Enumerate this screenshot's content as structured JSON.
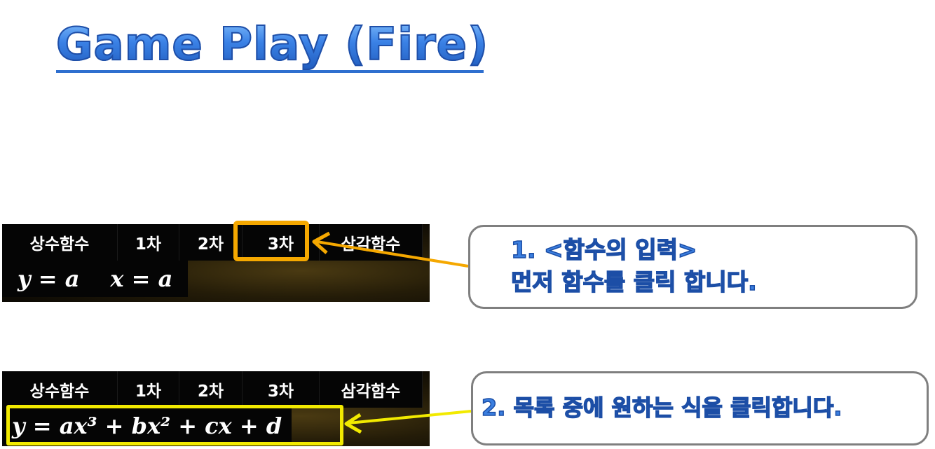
{
  "title": "Game Play (Fire)",
  "panel1": {
    "tabs": [
      "상수함수",
      "1차",
      "2차",
      "3차",
      "삼각함수"
    ],
    "functions": [
      "y = a",
      "x = a"
    ]
  },
  "panel2": {
    "tabs": [
      "상수함수",
      "1차",
      "2차",
      "3차",
      "삼각함수"
    ],
    "functions": [
      "y = ax³ + bx² + cx + d"
    ]
  },
  "callout1": {
    "line1": "1. <함수의 입력>",
    "line2": "먼저 함수를 클릭 합니다."
  },
  "callout2": {
    "line1": "2. 목록 중에 원하는 식을 클릭합니다."
  },
  "colors": {
    "title_blue": "#2e6fcf",
    "highlight_orange": "#f5a800",
    "highlight_yellow": "#f2ea00",
    "callout_text": "#3b7fe0",
    "callout_border": "#7f7f7f"
  }
}
